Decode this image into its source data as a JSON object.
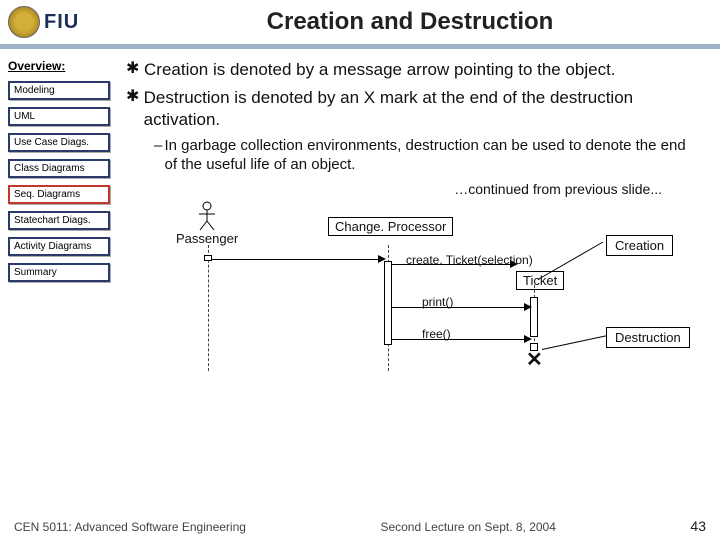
{
  "header": {
    "logo_text": "FIU",
    "title": "Creation and Destruction"
  },
  "sidebar": {
    "heading": "Overview:",
    "items": [
      {
        "label": "Modeling",
        "active": false
      },
      {
        "label": "UML",
        "active": false
      },
      {
        "label": "Use Case Diags.",
        "active": false
      },
      {
        "label": "Class Diagrams",
        "active": false
      },
      {
        "label": "Seq. Diagrams",
        "active": true
      },
      {
        "label": "Statechart Diags.",
        "active": false
      },
      {
        "label": "Activity Diagrams",
        "active": false
      },
      {
        "label": "Summary",
        "active": false
      }
    ]
  },
  "content": {
    "bullets": [
      "Creation is denoted by a message arrow pointing to the object.",
      "Destruction is denoted by an X mark at the end of the destruction activation."
    ],
    "subbullet": "In garbage collection environments, destruction can be used to denote the end of the useful life of an object.",
    "continued": "…continued from previous slide..."
  },
  "diagram": {
    "actor": "Passenger",
    "objects": {
      "processor": "Change. Processor",
      "ticket": "Ticket"
    },
    "messages": {
      "create": "create. Ticket(selection)",
      "print": "print()",
      "free": "free()"
    },
    "callouts": {
      "creation": "Creation",
      "destruction": "Destruction"
    },
    "x_mark": "✕"
  },
  "footer": {
    "left": "CEN 5011: Advanced Software Engineering",
    "right": "Second Lecture on Sept. 8, 2004",
    "slide": "43"
  }
}
